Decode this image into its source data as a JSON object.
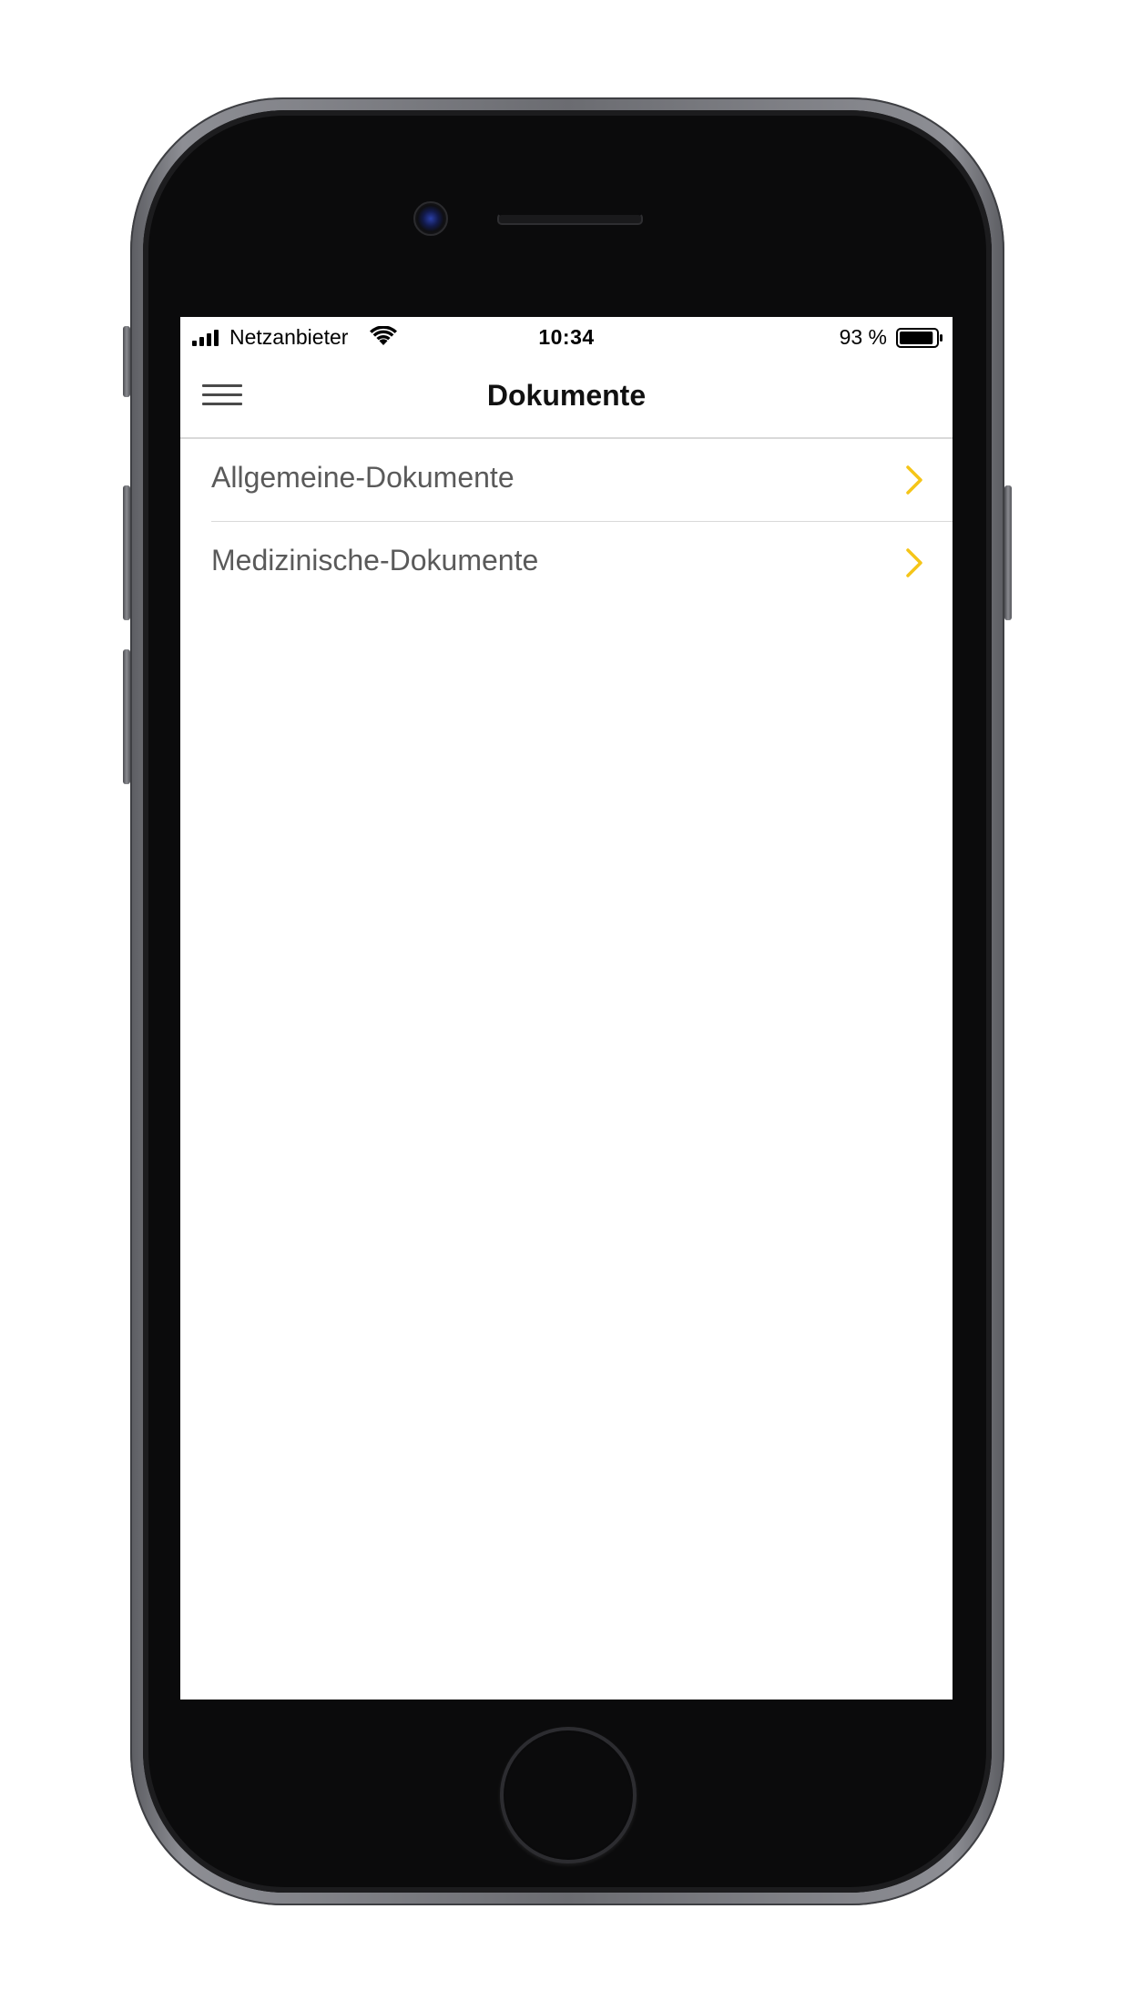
{
  "status_bar": {
    "carrier": "Netzanbieter",
    "time": "10:34",
    "battery_percent": "93 %",
    "battery_level": 0.93,
    "signal_icon": "cellular-signal-icon",
    "wifi_icon": "wifi-icon",
    "battery_icon": "battery-icon"
  },
  "nav_bar": {
    "title": "Dokumente",
    "menu_icon": "hamburger-menu-icon"
  },
  "documents": {
    "items": [
      {
        "label": "Allgemeine-Dokumente",
        "icon": "chevron-right-icon"
      },
      {
        "label": "Medizinische-Dokumente",
        "icon": "chevron-right-icon"
      }
    ]
  },
  "colors": {
    "accent": "#F5C518",
    "text": "#5A5A5A",
    "title": "#111111",
    "divider": "#D9D9D9",
    "phone_body": "#0B0B0C"
  }
}
